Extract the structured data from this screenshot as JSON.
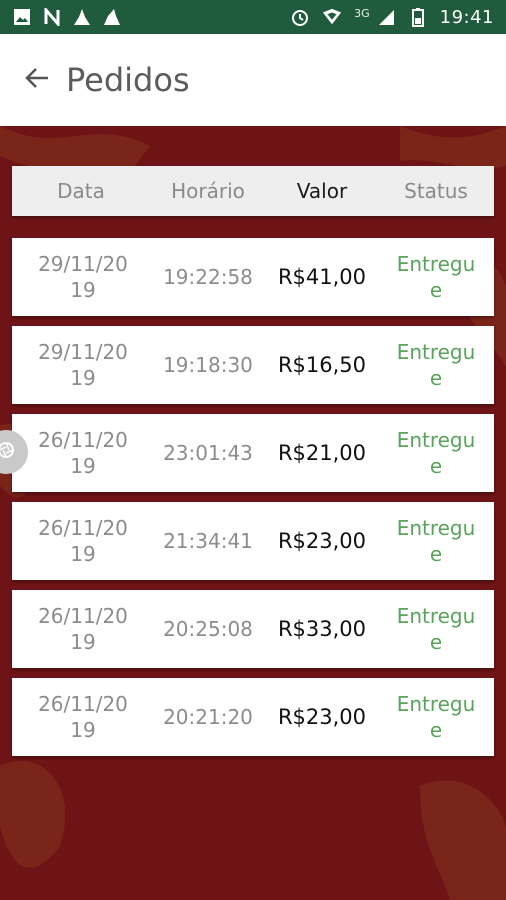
{
  "status_bar": {
    "time": "19:41",
    "network": "3G",
    "left_icons": [
      "image-icon",
      "n-icon",
      "cleaner-icon",
      "cleaner2-icon"
    ],
    "right_icons": [
      "alarm-icon",
      "wifi-icon",
      "signal-icon",
      "battery-icon"
    ]
  },
  "app_bar": {
    "title": "Pedidos",
    "back_icon": "arrow-left-icon"
  },
  "table": {
    "headers": [
      "Data",
      "Horário",
      "Valor",
      "Status"
    ],
    "rows": [
      {
        "date": "29/11/2019",
        "time": "19:22:58",
        "value": "R$41,00",
        "status": "Entregue"
      },
      {
        "date": "29/11/2019",
        "time": "19:18:30",
        "value": "R$16,50",
        "status": "Entregue"
      },
      {
        "date": "26/11/2019",
        "time": "23:01:43",
        "value": "R$21,00",
        "status": "Entregue"
      },
      {
        "date": "26/11/2019",
        "time": "21:34:41",
        "value": "R$23,00",
        "status": "Entregue"
      },
      {
        "date": "26/11/2019",
        "time": "20:25:08",
        "value": "R$33,00",
        "status": "Entregue"
      },
      {
        "date": "26/11/2019",
        "time": "20:21:20",
        "value": "R$23,00",
        "status": "Entregue"
      }
    ]
  },
  "colors": {
    "status_bar": "#1f5b3c",
    "background": "#6e1416",
    "status_text": "#5aa35a"
  }
}
